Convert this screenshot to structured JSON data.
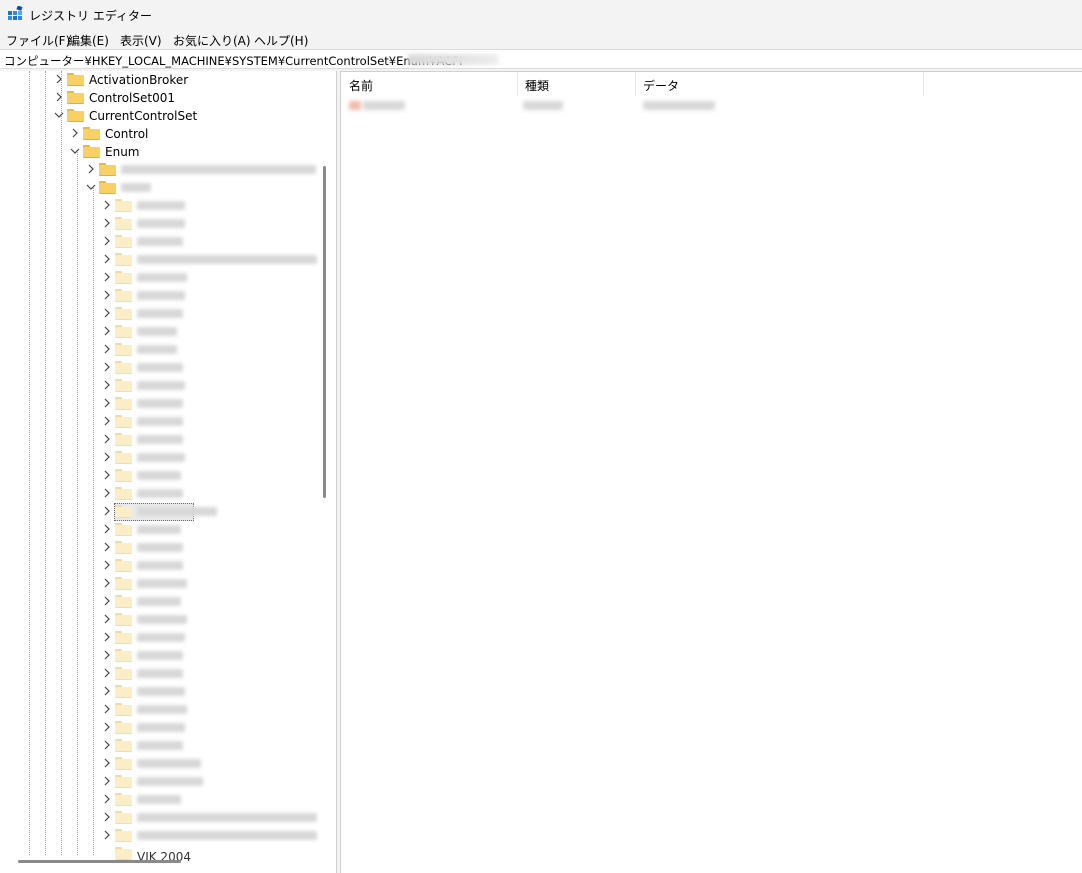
{
  "window": {
    "title": "レジストリ エディター",
    "icon": "registry-editor-icon"
  },
  "menu": [
    {
      "label": "ファイル(F)"
    },
    {
      "label": "編集(E)"
    },
    {
      "label": "表示(V)"
    },
    {
      "label": "お気に入り(A)"
    },
    {
      "label": "ヘルプ(H)"
    }
  ],
  "address": {
    "path": "コンピューター¥HKEY_LOCAL_MACHINE¥SYSTEM¥CurrentControlSet¥Enum¥ACPI"
  },
  "tree": {
    "activation_broker": "ActivationBroker",
    "control_set_001": "ControlSet001",
    "current_control_set": "CurrentControlSet",
    "control": "Control",
    "enum": "Enum",
    "last_partial": "VIK 2004"
  },
  "columns": {
    "name": "名前",
    "type": "種類",
    "data": "データ"
  },
  "colors": {
    "folder": "#f8d063",
    "selection": "#eaeaea"
  }
}
